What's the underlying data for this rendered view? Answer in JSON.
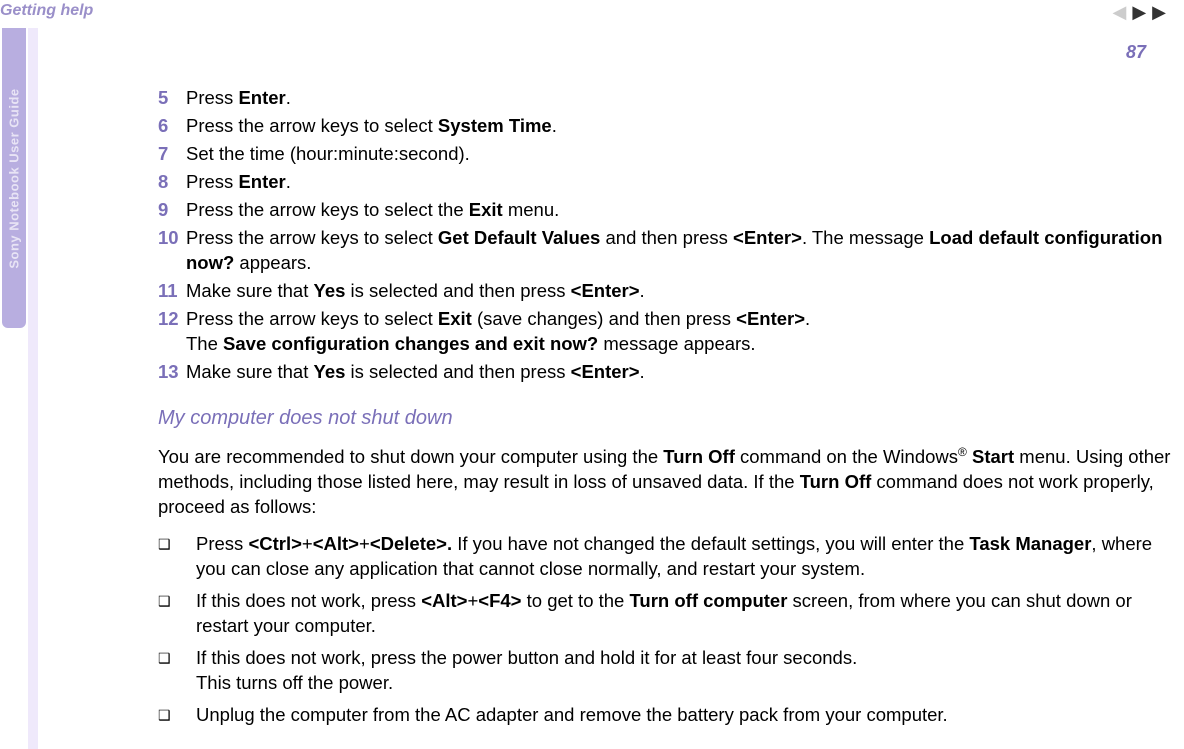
{
  "header": {
    "title": "Getting help",
    "page_number": "87"
  },
  "sidebar": {
    "label": "Sony Notebook User Guide"
  },
  "nav": {
    "left": "◀",
    "right1": "▶",
    "right2": "▶"
  },
  "steps": {
    "s5": {
      "num": "5",
      "t1": "Press ",
      "b1": "Enter",
      "t2": "."
    },
    "s6": {
      "num": "6",
      "t1": "Press the arrow keys to select ",
      "b1": "System Time",
      "t2": "."
    },
    "s7": {
      "num": "7",
      "t1": "Set the time (hour:minute:second)."
    },
    "s8": {
      "num": "8",
      "t1": "Press ",
      "b1": "Enter",
      "t2": "."
    },
    "s9": {
      "num": "9",
      "t1": "Press the arrow keys to select the ",
      "b1": "Exit",
      "t2": " menu."
    },
    "s10": {
      "num": "10",
      "t1": "Press the arrow keys to select ",
      "b1": "Get Default Values",
      "t2": " and then press ",
      "b2": "<Enter>",
      "t3": ". The message ",
      "b3": "Load default configuration now?",
      "t4": " appears."
    },
    "s11": {
      "num": "11",
      "t1": "Make sure that ",
      "b1": "Yes",
      "t2": " is selected and then press ",
      "b2": "<Enter>",
      "t3": "."
    },
    "s12": {
      "num": "12",
      "t1": "Press the arrow keys to select ",
      "b1": "Exit",
      "t2": " (save changes) and then press ",
      "b2": "<Enter>",
      "t3": ".",
      "t4": "The ",
      "b3": "Save configuration changes and exit now?",
      "t5": " message appears."
    },
    "s13": {
      "num": "13",
      "t1": "Make sure that ",
      "b1": "Yes",
      "t2": " is selected and then press ",
      "b2": "<Enter>",
      "t3": "."
    }
  },
  "subheading": "My computer does not shut down",
  "para": {
    "t1": "You are recommended to shut down your computer using the ",
    "b1": "Turn Off",
    "t2": " command on the Windows",
    "sup": "®",
    "b2": " Start",
    "t3": " menu. Using other methods, including those listed here, may result in loss of unsaved data. If the ",
    "b3": "Turn Off",
    "t4": " command does not work properly, proceed as follows:"
  },
  "bullets": {
    "b1": {
      "t1": "Press ",
      "bd1": "<Ctrl>",
      "t2": "+",
      "bd2": "<Alt>",
      "t3": "+",
      "bd3": "<Delete>.",
      "t4": " If you have not changed the default settings, you will enter the ",
      "bd4": "Task Manager",
      "t5": ", where you can close any application that cannot close normally, and restart your system."
    },
    "b2": {
      "t1": "If this does not work, press ",
      "bd1": "<Alt>",
      "t2": "+",
      "bd2": "<F4>",
      "t3": " to get to the ",
      "bd3": "Turn off computer",
      "t4": " screen, from where you can shut down or restart your computer."
    },
    "b3": {
      "t1": "If this does not work, press the power button and hold it for at least four seconds.",
      "t2": "This turns off the power."
    },
    "b4": {
      "t1": "Unplug the computer from the AC adapter and remove the battery pack from your computer."
    }
  }
}
